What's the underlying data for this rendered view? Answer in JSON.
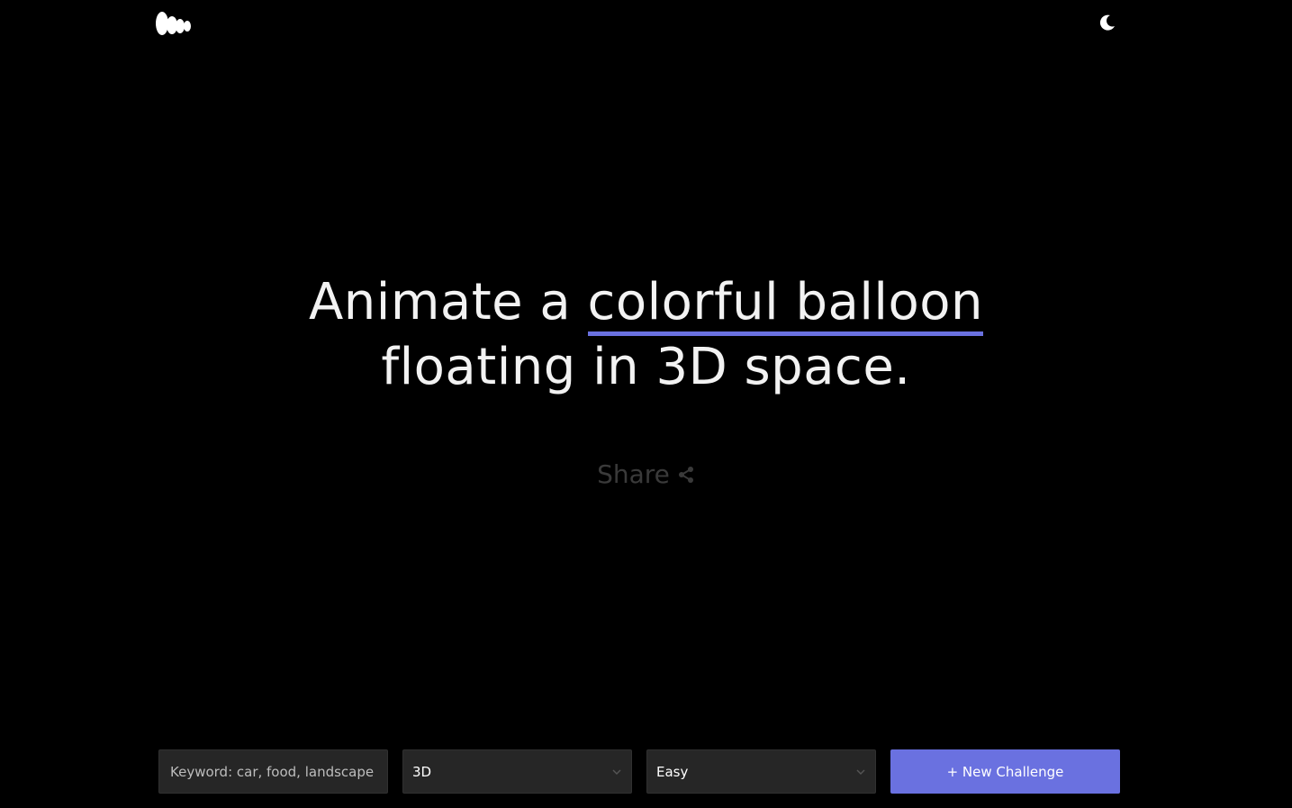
{
  "header": {
    "logo_icon": "blob-logo-icon",
    "theme_icon": "moon-icon"
  },
  "challenge": {
    "prefix": "Animate a ",
    "highlight": "colorful balloon",
    "line2": "floating in 3D space.",
    "highlight_color": "#6a71e0"
  },
  "share": {
    "label": "Share",
    "icon": "share-icon"
  },
  "controls": {
    "keyword_placeholder": "Keyword: car, food, landscape",
    "type_selected": "3D",
    "difficulty_selected": "Easy",
    "new_challenge_label": "+ New Challenge",
    "accent": "#6a71e0"
  }
}
